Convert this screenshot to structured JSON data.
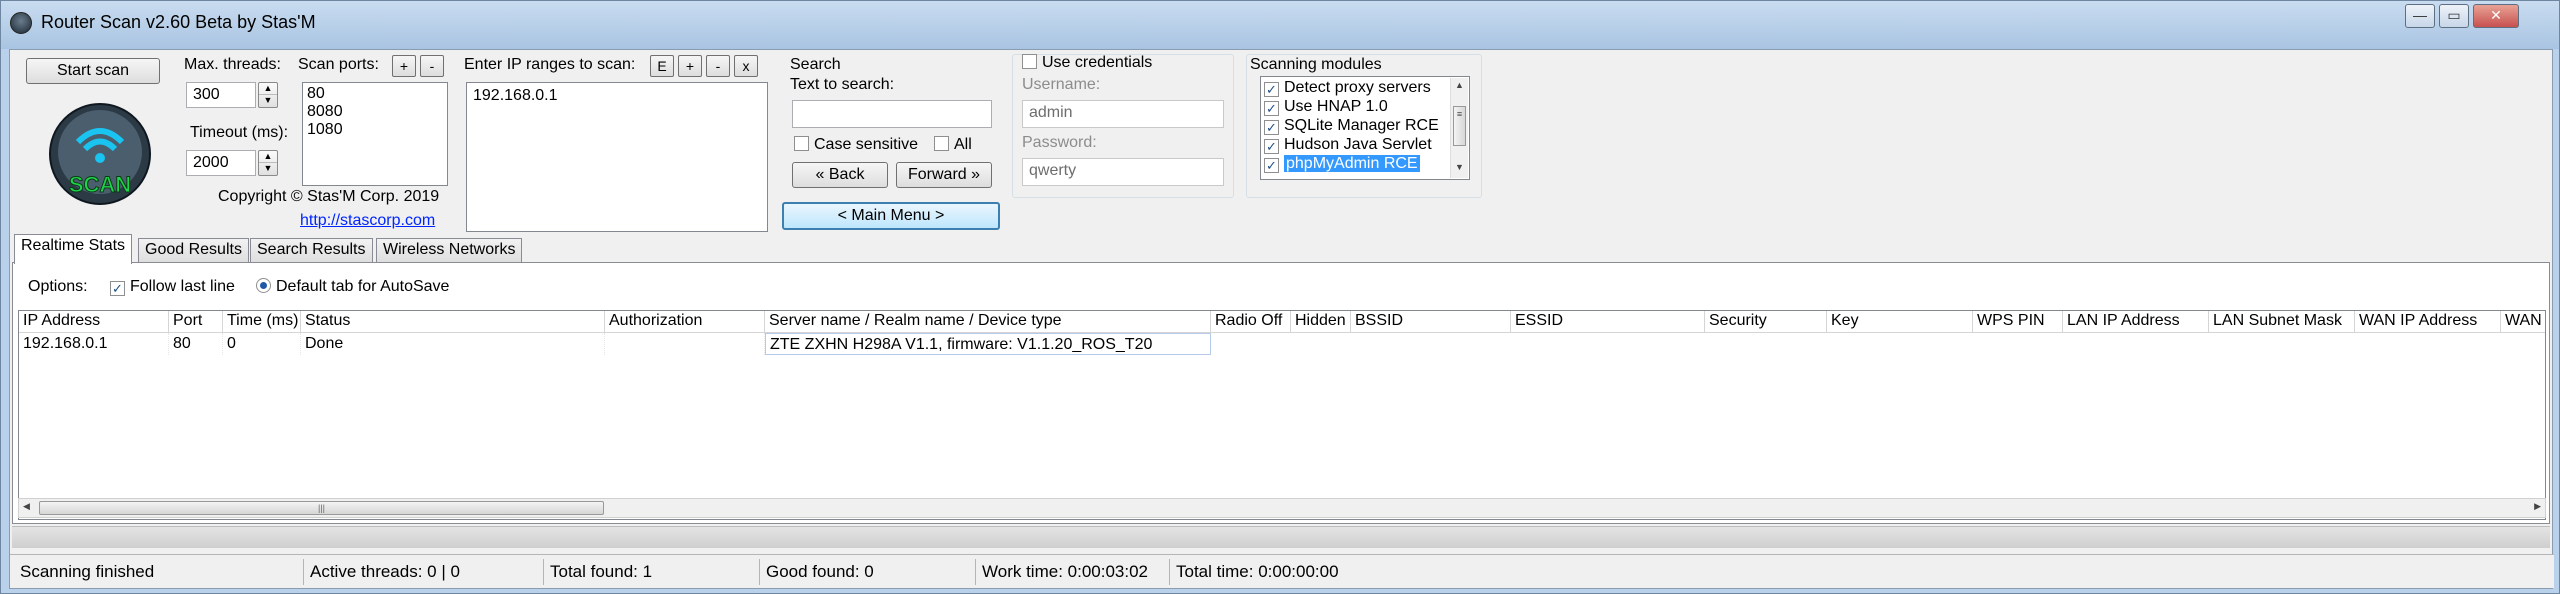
{
  "window": {
    "title": "Router Scan v2.60 Beta by Stas'M"
  },
  "toolbar": {
    "start_scan": "Start scan",
    "max_threads_label": "Max. threads:",
    "max_threads_value": "300",
    "timeout_label": "Timeout (ms):",
    "timeout_value": "2000",
    "scan_ports_label": "Scan ports:",
    "ports": [
      "80",
      "8080",
      "1080"
    ],
    "ip_ranges_label": "Enter IP ranges to scan:",
    "ip_ranges": [
      "192.168.0.1"
    ],
    "btn_e": "E",
    "btn_plus": "+",
    "btn_minus": "-",
    "btn_x": "x",
    "copyright": "Copyright © Stas'M Corp. 2019",
    "link": "http://stascorp.com",
    "logo_text": "SCAN"
  },
  "search": {
    "title": "Search",
    "text_label": "Text to search:",
    "text_value": "",
    "case_sensitive": "Case sensitive",
    "all": "All",
    "back": "« Back",
    "forward": "Forward »",
    "main_menu": "< Main Menu >"
  },
  "credentials": {
    "use_label": "Use credentials",
    "username_label": "Username:",
    "username_value": "admin",
    "password_label": "Password:",
    "password_value": "qwerty"
  },
  "modules": {
    "title": "Scanning modules",
    "items": [
      "Detect proxy servers",
      "Use HNAP 1.0",
      "SQLite Manager RCE",
      "Hudson Java Servlet",
      "phpMyAdmin RCE"
    ]
  },
  "tabs": [
    "Realtime Stats",
    "Good Results",
    "Search Results",
    "Wireless Networks"
  ],
  "options": {
    "label": "Options:",
    "follow_last_line": "Follow last line",
    "default_tab": "Default tab for AutoSave"
  },
  "grid": {
    "columns": [
      "IP Address",
      "Port",
      "Time (ms)",
      "Status",
      "Authorization",
      "Server name / Realm name / Device type",
      "Radio Off",
      "Hidden",
      "BSSID",
      "ESSID",
      "Security",
      "Key",
      "WPS PIN",
      "LAN IP Address",
      "LAN Subnet Mask",
      "WAN IP Address",
      "WAN Su"
    ],
    "rows": [
      {
        "ip": "192.168.0.1",
        "port": "80",
        "time": "0",
        "status": "Done",
        "auth": "",
        "server": "ZTE ZXHN H298A V1.1, firmware: V1.1.20_ROS_T20"
      }
    ]
  },
  "statusbar": {
    "state": "Scanning finished",
    "active_threads": "Active threads: 0 | 0",
    "total_found": "Total found: 1",
    "good_found": "Good found: 0",
    "work_time": "Work time: 0:00:03:02",
    "total_time": "Total time: 0:00:00:00"
  }
}
